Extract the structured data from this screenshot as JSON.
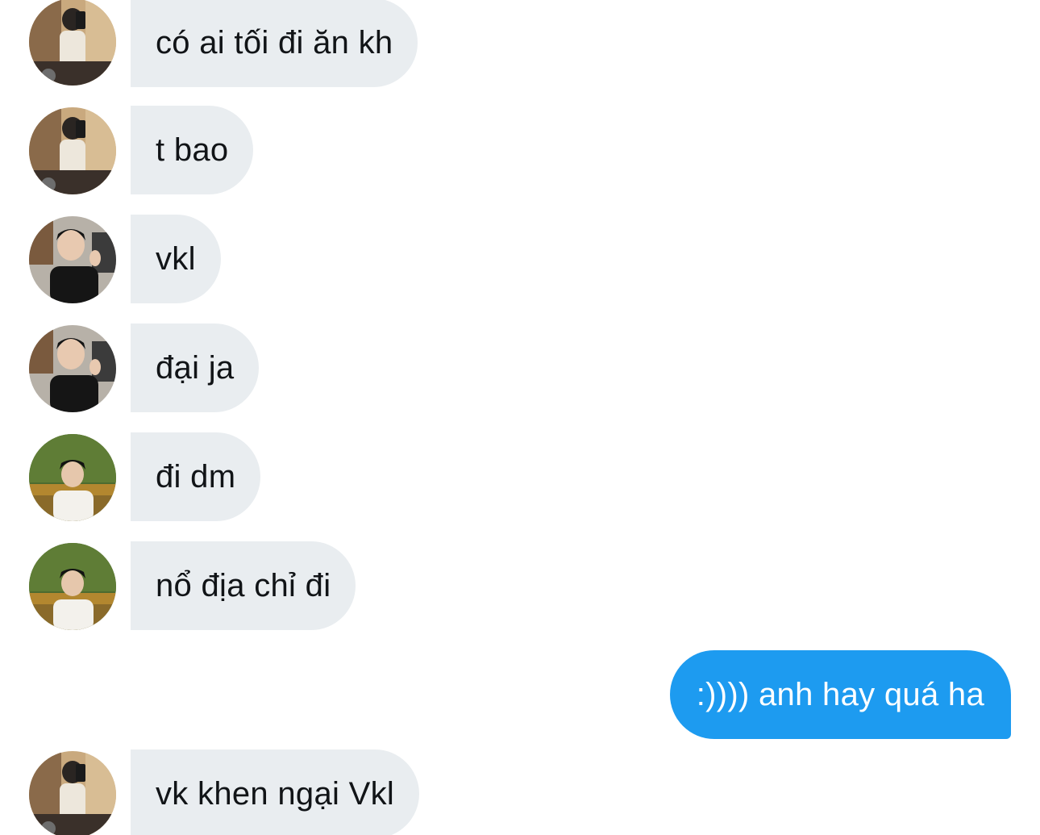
{
  "conversation": {
    "messages": [
      {
        "direction": "incoming",
        "sender_avatar": "avatar-user-a",
        "text": "có ai tối đi ăn kh"
      },
      {
        "direction": "incoming",
        "sender_avatar": "avatar-user-a",
        "text": "t bao"
      },
      {
        "direction": "incoming",
        "sender_avatar": "avatar-user-b",
        "text": "vkl"
      },
      {
        "direction": "incoming",
        "sender_avatar": "avatar-user-b",
        "text": "đại ja"
      },
      {
        "direction": "incoming",
        "sender_avatar": "avatar-user-c",
        "text": "đi dm"
      },
      {
        "direction": "incoming",
        "sender_avatar": "avatar-user-c",
        "text": "nổ địa chỉ đi"
      },
      {
        "direction": "outgoing",
        "text": ":)))) anh hay quá ha"
      },
      {
        "direction": "incoming",
        "sender_avatar": "avatar-user-a",
        "text": "vk khen ngại Vkl"
      }
    ]
  },
  "colors": {
    "incoming_bubble": "#e9edf0",
    "incoming_text": "#111417",
    "outgoing_bubble": "#1d9bf0",
    "outgoing_text": "#ffffff",
    "background": "#ffffff"
  }
}
